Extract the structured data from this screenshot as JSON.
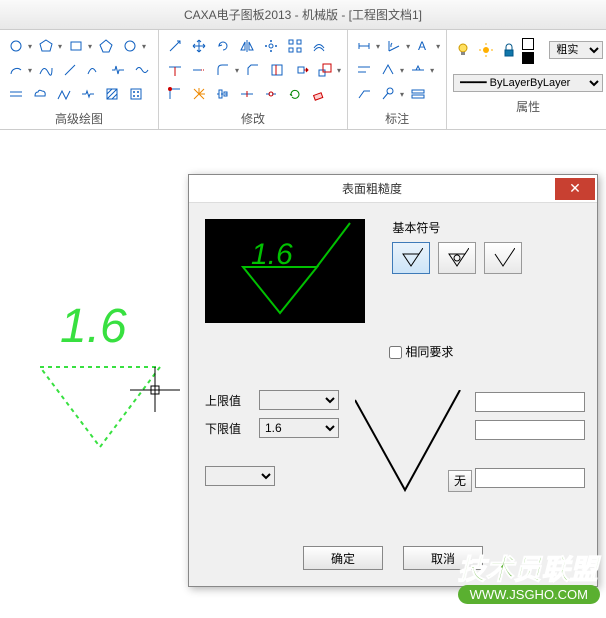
{
  "app_title": "CAXA电子图板2013 - 机械版 - [工程图文档1]",
  "ribbon": {
    "groups": {
      "advanced_draw": {
        "label": "高级绘图"
      },
      "modify": {
        "label": "修改"
      },
      "annotate": {
        "label": "标注"
      },
      "properties": {
        "label": "属性"
      }
    },
    "properties": {
      "lineweight": "粗实",
      "linetype": "ByLayer"
    }
  },
  "dialog": {
    "title": "表面粗糙度",
    "preview_value": "1.6",
    "symbol_group_label": "基本符号",
    "same_requirement_label": "相同要求",
    "upper_label": "上限值",
    "lower_label": "下限值",
    "upper_value": "",
    "lower_value": "1.6",
    "none_label": "无",
    "ok_label": "确定",
    "cancel_label": "取消"
  },
  "canvas": {
    "ghost_value": "1.6"
  },
  "watermark": {
    "text": "技术员联盟",
    "url": "WWW.JSGHO.COM"
  }
}
